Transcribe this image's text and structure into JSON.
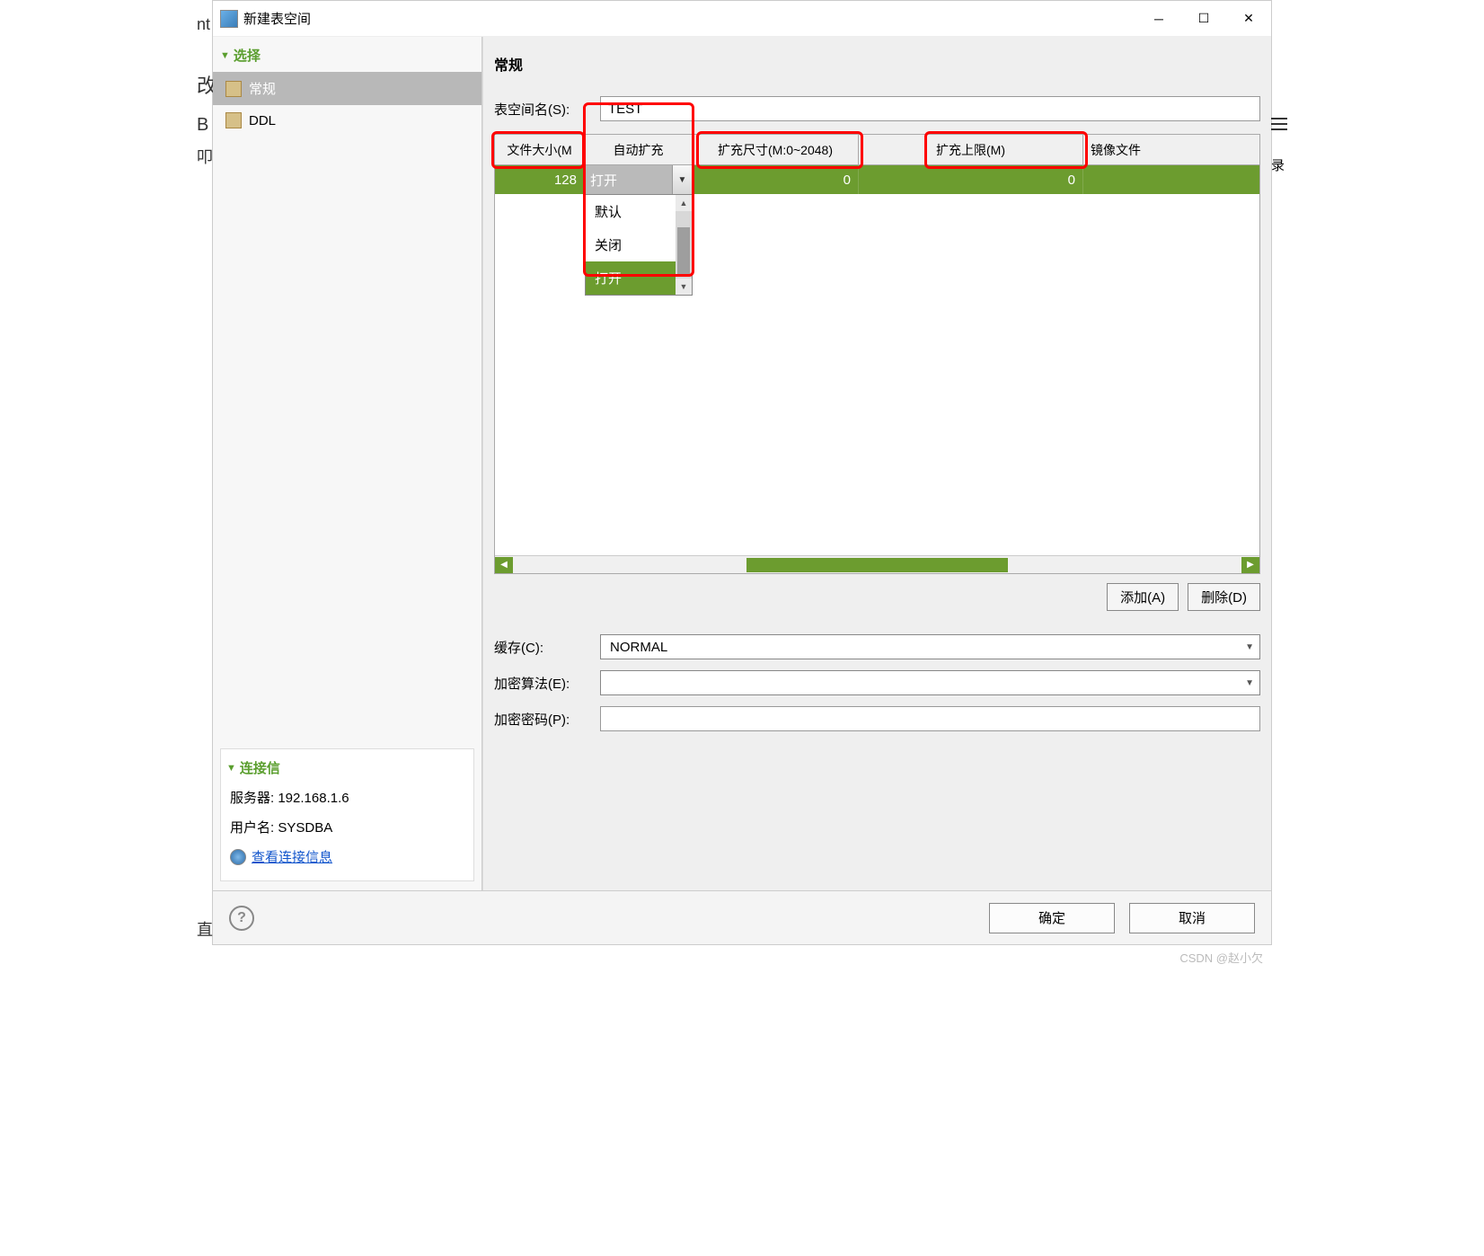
{
  "window": {
    "title": "新建表空间"
  },
  "sidebar": {
    "section_select": "选择",
    "items": [
      {
        "label": "常规"
      },
      {
        "label": "DDL"
      }
    ],
    "section_conn": "连接信",
    "server_label": "服务器:",
    "server_value": "192.168.1.6",
    "user_label": "用户名:",
    "user_value": "SYSDBA",
    "conn_link": "查看连接信息"
  },
  "main": {
    "heading": "常规",
    "name_label": "表空间名(S):",
    "name_value": "TEST",
    "columns": {
      "c1": "文件大小(M",
      "c2": "自动扩充",
      "c3": "扩充尺寸(M:0~2048)",
      "c4": "扩充上限(M)",
      "c5": "镜像文件"
    },
    "row": {
      "file_size": "128",
      "auto_expand_value": "打开",
      "expand_size": "0",
      "expand_limit": "0"
    },
    "dropdown": {
      "opt1": "默认",
      "opt2": "关闭",
      "opt3": "打开"
    },
    "add_btn": "添加(A)",
    "del_btn": "删除(D)",
    "cache_label": "缓存(C):",
    "cache_value": "NORMAL",
    "enc_algo_label": "加密算法(E):",
    "enc_algo_value": "",
    "enc_pwd_label": "加密密码(P):",
    "enc_pwd_value": ""
  },
  "footer": {
    "help": "?",
    "ok": "确定",
    "cancel": "取消"
  },
  "watermark": "CSDN @赵小欠",
  "edge": {
    "left_top": "nt",
    "left_mid": "改",
    "left_b": "B",
    "left_b2": "叩",
    "left_bottom": "直",
    "right": "录"
  }
}
